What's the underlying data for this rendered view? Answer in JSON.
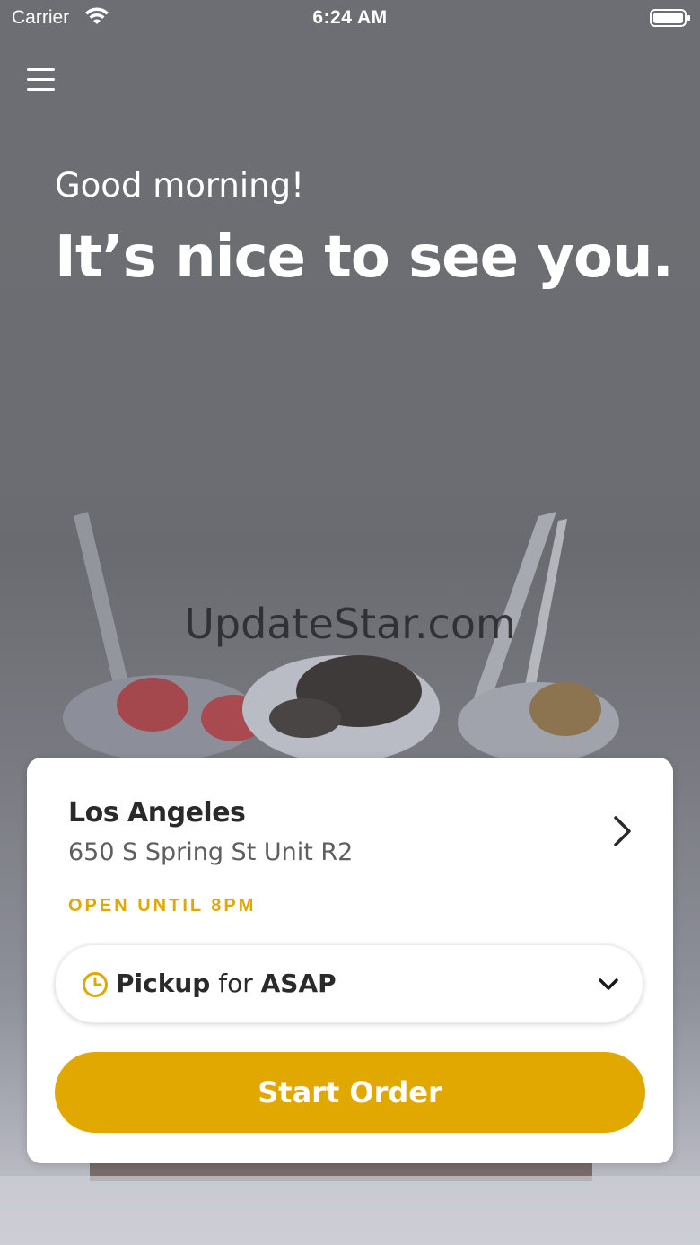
{
  "status_bar": {
    "carrier": "Carrier",
    "time": "6:24 AM"
  },
  "header": {
    "greeting": "Good morning!",
    "headline": "It’s nice to see you."
  },
  "watermark": "UpdateStar.com",
  "store_card": {
    "city": "Los Angeles",
    "address": "650 S Spring St Unit R2",
    "hours": "OPEN UNTIL 8PM",
    "pickup": {
      "mode": "Pickup",
      "connector": "for",
      "time": "ASAP"
    },
    "start_order_label": "Start Order"
  },
  "colors": {
    "accent": "#E0A800",
    "background_overlay": "#6B6C71",
    "card": "#FFFFFF"
  },
  "icons": {
    "menu": "hamburger-icon",
    "wifi": "wifi-icon",
    "battery": "battery-icon",
    "store_chevron": "chevron-right-icon",
    "clock": "clock-icon",
    "dropdown": "chevron-down-icon"
  }
}
